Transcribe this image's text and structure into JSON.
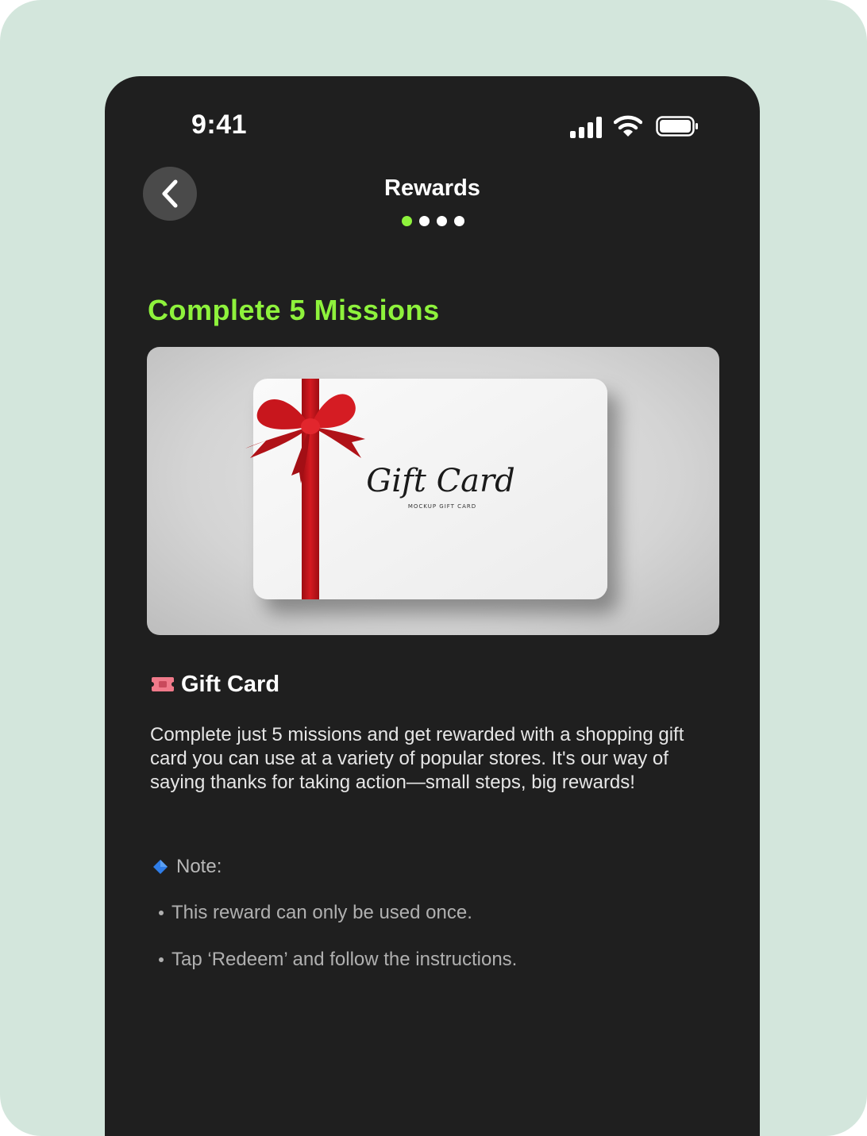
{
  "status_bar": {
    "time": "9:41",
    "icons": [
      "signal-icon",
      "wifi-icon",
      "battery-icon"
    ]
  },
  "header": {
    "title": "Rewards",
    "back_icon": "chevron-left-icon",
    "pagination": {
      "total": 4,
      "active_index": 0
    }
  },
  "mission": {
    "title": "Complete 5 Missions"
  },
  "hero": {
    "card_text": "Gift Card",
    "card_subtext": "MOCKUP GIFT CARD"
  },
  "reward": {
    "icon": "ticket-icon",
    "name": "Gift Card",
    "description": "Complete just 5 missions and get rewarded with a shopping gift card you can use at a variety of popular stores. It's our way of saying thanks for taking action—small steps, big rewards!"
  },
  "note": {
    "icon": "diamond-icon",
    "label": "Note:",
    "items": [
      "This reward can only be used once.",
      "Tap ‘Redeem’ and follow the instructions."
    ]
  },
  "colors": {
    "background": "#d3e6dc",
    "screen": "#1f1f1f",
    "accent": "#8ef23c",
    "ribbon": "#c0141b"
  }
}
